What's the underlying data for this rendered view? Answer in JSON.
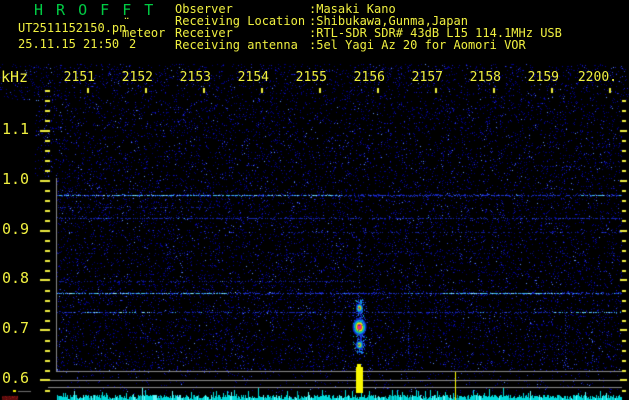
{
  "header": {
    "app_title": "H R O F F T",
    "filename": "UT2511152150.pn",
    "filename_overlay_marks": "¨",
    "mode_label": "meteor",
    "date_time": "25.11.15 21:50",
    "echo_count": "2",
    "info_fields": [
      {
        "label": "Observer",
        "separator": ":",
        "value": "Masaki Kano"
      },
      {
        "label": "Receiving Location",
        "separator": ":",
        "value": "Shibukawa,Gunma,Japan"
      },
      {
        "label": "Receiver",
        "separator": ":",
        "value": "RTL-SDR SDR# 43dB L15 114.1MHz USB"
      },
      {
        "label": "Receiving antenna",
        "separator": ":",
        "value": "5el Yagi Az 20 for Aomori VOR"
      }
    ]
  },
  "chart_data": {
    "type": "heatmap",
    "title": "HROFFT 10-minute radio meteor echo spectrogram",
    "x_axis": {
      "unit": "UT time hhmm",
      "start": "21:50",
      "end": "22:00",
      "minutes_per_division": 1,
      "tick_labels": [
        "2151",
        "2152",
        "2153",
        "2154",
        "2155",
        "2156",
        "2157",
        "2158",
        "2159",
        "2200."
      ]
    },
    "y_axis": {
      "unit_label": "kHz",
      "tick_labels": [
        "1.1",
        "1.0",
        "0.9",
        "0.8",
        "0.7",
        "0.6"
      ],
      "minor_step_khz": 0.02,
      "range_khz": [
        0.6,
        1.18
      ]
    },
    "carrier_lines": [
      {
        "freq_khz": 1.028,
        "from_min": 8.8,
        "to_min": 10.22,
        "level": "sparse"
      },
      {
        "freq_khz": 0.97,
        "from_min": 0.48,
        "to_min": 10.22,
        "level": "bright",
        "bright_segments": [
          [
            0.48,
            5.4
          ],
          [
            9.5,
            10.2
          ]
        ]
      },
      {
        "freq_khz": 0.945,
        "from_min": 0.48,
        "to_min": 3.2,
        "level": "faint"
      },
      {
        "freq_khz": 0.923,
        "from_min": 0.48,
        "to_min": 10.22,
        "level": "medium"
      },
      {
        "freq_khz": 0.895,
        "from_min": 4.3,
        "to_min": 10.22,
        "level": "faint"
      },
      {
        "freq_khz": 0.853,
        "from_min": 0.48,
        "to_min": 10.22,
        "level": "sparse"
      },
      {
        "freq_khz": 0.797,
        "from_min": 0.48,
        "to_min": 5.6,
        "level": "faint"
      },
      {
        "freq_khz": 0.773,
        "from_min": 0.48,
        "to_min": 10.22,
        "level": "bright",
        "bright_segments": [
          [
            0.48,
            3.5
          ],
          [
            7.1,
            9.2
          ]
        ]
      },
      {
        "freq_khz": 0.735,
        "from_min": 0.48,
        "to_min": 10.22,
        "level": "medium",
        "bright_segments": [
          [
            0.9,
            2.1
          ],
          [
            9.05,
            10.2
          ]
        ]
      }
    ],
    "meteor_echo": {
      "time_min_after_2150": 5.69,
      "time_utc": "21:55:41",
      "freq_center_khz": 0.7,
      "blobs": [
        {
          "freq_khz": 0.743,
          "size": "small",
          "core": "red"
        },
        {
          "freq_khz": 0.704,
          "size": "large",
          "core": "magenta"
        },
        {
          "freq_khz": 0.668,
          "size": "small",
          "core": "orange"
        }
      ],
      "halo_span_khz": [
        0.76,
        0.65
      ],
      "meter_bar": true
    },
    "faint_vertical_streaks_min": [
      {
        "time_min": 5.69,
        "freq_from_khz": 0.882,
        "freq_to_khz": 0.758
      },
      {
        "time_min": 6.53,
        "freq_from_khz": 0.795,
        "freq_to_khz": 0.616
      },
      {
        "time_min": 9.24,
        "freq_from_khz": 0.74,
        "freq_to_khz": 0.616
      },
      {
        "time_min": 9.7,
        "freq_from_khz": 0.72,
        "freq_to_khz": 0.616
      }
    ],
    "meter_strip": {
      "thin_marker_line_min": 7.35,
      "event_bar_min": 5.69,
      "noise_description": "continuous cyan signal-level noise band along bottom"
    }
  },
  "palette": {
    "text_yellow": "#f0f040",
    "title_green": "#00cc44",
    "noise_blue": "#0000a0",
    "carrier_bright_cyan": "#44ccf0",
    "grid_gray": "#8a8a8a",
    "meter_cyan": "#00dcdc",
    "event_yellow": "#f8f800",
    "echo_core_magenta": "#f818a0",
    "corner_dark_red": "#5a0c0c"
  }
}
